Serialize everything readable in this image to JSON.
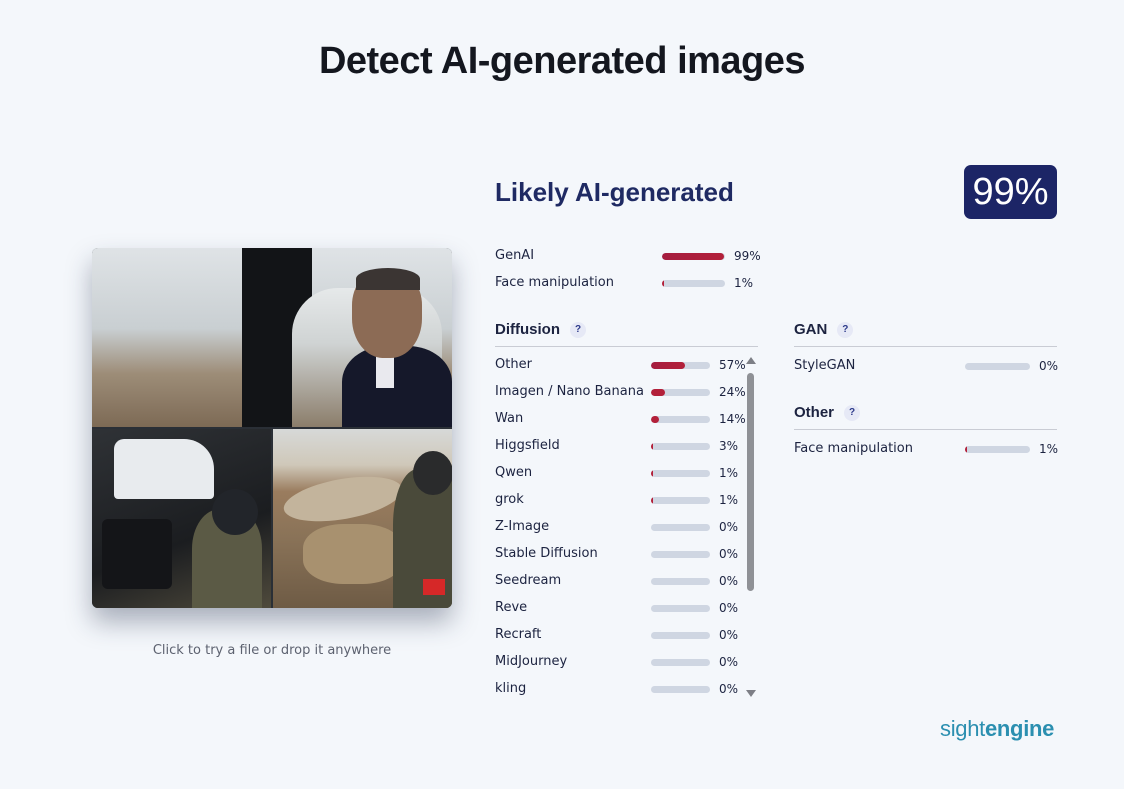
{
  "page": {
    "title": "Detect AI-generated images"
  },
  "upload": {
    "hint": "Click to try a file or drop it anywhere"
  },
  "result": {
    "verdict": "Likely AI-generated",
    "score": "99%",
    "summary": [
      {
        "label": "GenAI",
        "pct": "99%",
        "value": 99
      },
      {
        "label": "Face manipulation",
        "pct": "1%",
        "value": 1
      }
    ]
  },
  "diffusion": {
    "title": "Diffusion",
    "help": "?",
    "items": [
      {
        "label": "Other",
        "pct": "57%",
        "value": 57
      },
      {
        "label": "Imagen / Nano Banana",
        "pct": "24%",
        "value": 24
      },
      {
        "label": "Wan",
        "pct": "14%",
        "value": 14
      },
      {
        "label": "Higgsfield",
        "pct": "3%",
        "value": 3
      },
      {
        "label": "Qwen",
        "pct": "1%",
        "value": 1
      },
      {
        "label": "grok",
        "pct": "1%",
        "value": 1
      },
      {
        "label": "Z-Image",
        "pct": "0%",
        "value": 0
      },
      {
        "label": "Stable Diffusion",
        "pct": "0%",
        "value": 0
      },
      {
        "label": "Seedream",
        "pct": "0%",
        "value": 0
      },
      {
        "label": "Reve",
        "pct": "0%",
        "value": 0
      },
      {
        "label": "Recraft",
        "pct": "0%",
        "value": 0
      },
      {
        "label": "MidJourney",
        "pct": "0%",
        "value": 0
      },
      {
        "label": "kling",
        "pct": "0%",
        "value": 0
      }
    ]
  },
  "gan": {
    "title": "GAN",
    "help": "?",
    "items": [
      {
        "label": "StyleGAN",
        "pct": "0%",
        "value": 0
      }
    ]
  },
  "other": {
    "title": "Other",
    "help": "?",
    "items": [
      {
        "label": "Face manipulation",
        "pct": "1%",
        "value": 1
      }
    ]
  },
  "brand": {
    "part1": "sight",
    "part2": "engine"
  },
  "colors": {
    "bar_fill": "#b3203a",
    "bar_track": "#cfd6e2",
    "badge": "#1c2566",
    "heading": "#1f2a63",
    "logo": "#2b8fb0"
  }
}
